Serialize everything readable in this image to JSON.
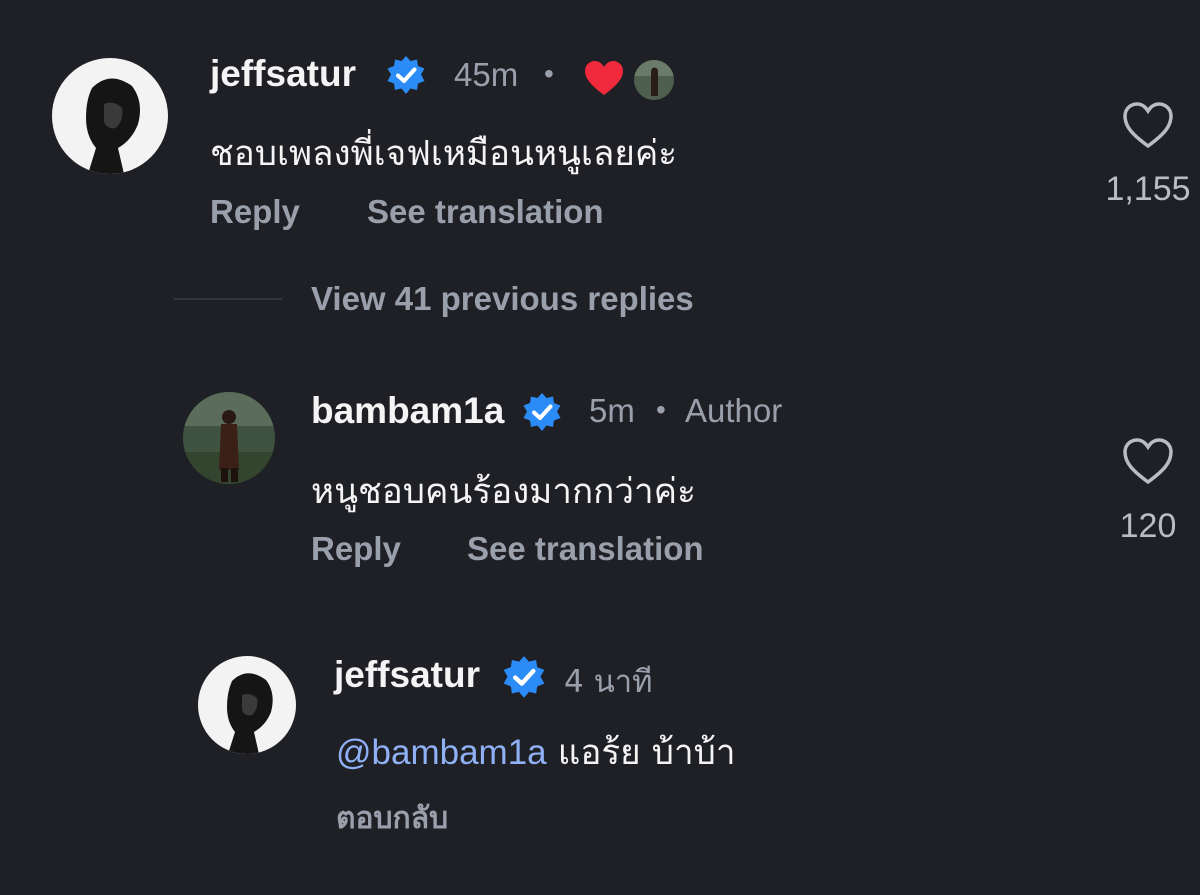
{
  "comment1": {
    "username": "jeffsatur",
    "time": "45m",
    "dot": "•",
    "text": "ชอบเพลงพี่เจฟเหมือนหนูเลยค่ะ",
    "reply_label": "Reply",
    "translate_label": "See translation",
    "like_count": "1,155"
  },
  "view_replies_label": "View 41 previous replies",
  "comment2": {
    "username": "bambam1a",
    "time": "5m",
    "dot": "•",
    "badge": "Author",
    "text": "หนูชอบคนร้องมากกว่าค่ะ",
    "reply_label": "Reply",
    "translate_label": "See translation",
    "like_count": "120"
  },
  "comment3": {
    "username": "jeffsatur",
    "time": "4 นาที",
    "mention": "@bambam1a",
    "text": "แอร้ย บ้าบ้า",
    "reply_label": "ตอบกลับ"
  },
  "colors": {
    "background": "#1f2025",
    "verified": "#2b8cf7",
    "heart": "#f02a3c",
    "mention": "#8fb0f5",
    "muted": "#9aa0ab"
  }
}
